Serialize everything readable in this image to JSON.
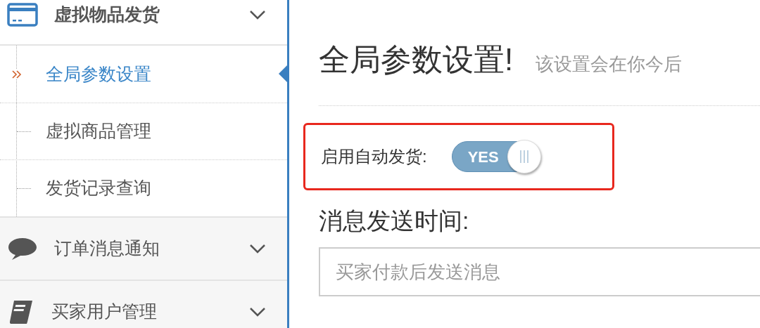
{
  "sidebar": {
    "groups": [
      {
        "kind": "card",
        "label": "虚拟物品发货",
        "expanded": true,
        "children": [
          {
            "label": "全局参数设置",
            "selected": true
          },
          {
            "label": "虚拟商品管理",
            "selected": false
          },
          {
            "label": "发货记录查询",
            "selected": false
          }
        ]
      },
      {
        "kind": "chat",
        "label": "订单消息通知",
        "expanded": false
      },
      {
        "kind": "book",
        "label": "买家用户管理",
        "expanded": false
      }
    ]
  },
  "page": {
    "title": "全局参数设置!",
    "subtitle": "该设置会在你今后"
  },
  "settings": [
    {
      "kind": "toggle",
      "label": "启用自动发货:",
      "on": true,
      "on_text": "YES",
      "highlighted": true
    }
  ],
  "message_time": {
    "label": "消息发送时间:",
    "placeholder": "买家付款后发送消息"
  }
}
